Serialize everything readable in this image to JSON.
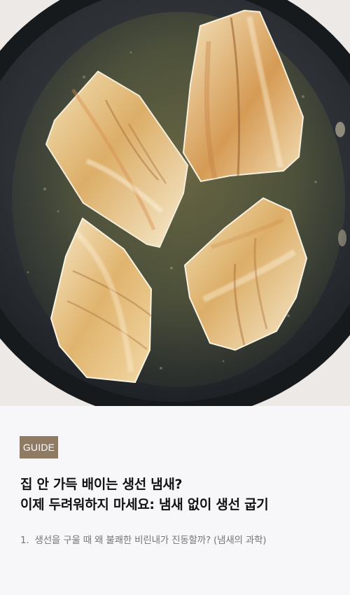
{
  "hero": {
    "image_name": "pan-seared-fish-fillets-photo",
    "subject": "four fish fillets searing in a black nonstick pan"
  },
  "article": {
    "badge": "GUIDE",
    "title_line_1": "집 안 가득 배이는 생선 냄새?",
    "title_line_2": "이제 두려워하지 마세요: 냄새 없이 생선 굽기",
    "toc": [
      {
        "number": "1.",
        "text": "생선을 구울 때 왜 불쾌한 비린내가 진동할까? (냄새의 과학)"
      }
    ]
  },
  "colors": {
    "badge_background": "#8f7a63",
    "title": "#111111",
    "toc_text": "#767676",
    "background": "#f7f7f9"
  }
}
